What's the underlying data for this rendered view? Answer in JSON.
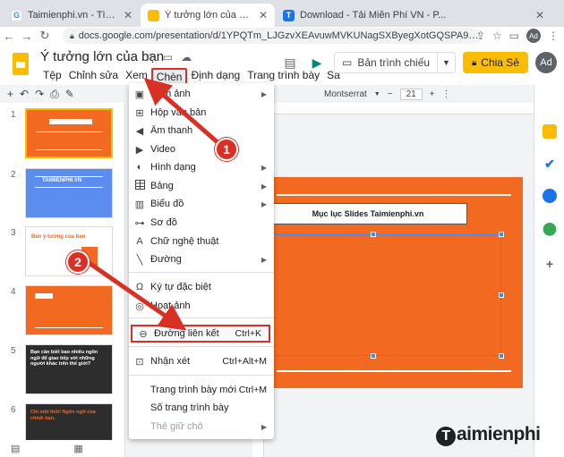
{
  "browser": {
    "tabs": [
      {
        "title": "Taimienphi.vn - Tìm trên Google",
        "favicon": "G",
        "color": "#4285f4"
      },
      {
        "title": "Ý tưởng lớn của bạn - Google Tr...",
        "favicon": "",
        "color": "#fbbc04"
      },
      {
        "title": "Download - Tải Miễn Phí VN - P...",
        "favicon": "T",
        "color": "#1a73e8"
      }
    ],
    "url": "docs.google.com/presentation/d/1YPQTm_LJGzvXEAvuwMVKUNagSXByegXotGQSPA9Cik/edit#slide=i...",
    "profile_initials": "Ad"
  },
  "header": {
    "doc_title": "Ý tưởng lớn của bạn",
    "menu": [
      "Tệp",
      "Chỉnh sửa",
      "Xem",
      "Chèn",
      "Định dạng",
      "Trang trình bày",
      "Sắ"
    ],
    "present_label": "Bản trình chiếu",
    "share_label": "Chia Sẻ",
    "avatar_initials": "Ad"
  },
  "toolbar": {
    "font_name": "Montserrat",
    "font_size": "21"
  },
  "slides": [
    {
      "num": "1",
      "bg": "#f26a21",
      "text": "Ý tưởng lớn của bạn"
    },
    {
      "num": "2",
      "bg": "#5b8def",
      "text": "TAIMIENPHI.VN"
    },
    {
      "num": "3",
      "bg": "#ffffff",
      "text": "Bản ý tưởng của bạn"
    },
    {
      "num": "4",
      "bg": "#f26a21",
      "text": ""
    },
    {
      "num": "5",
      "bg": "#2d2d2d",
      "text": "Bạn cần biết bao nhiêu ngôn ngữ để giao tiếp với những người khác trên thế giới?"
    },
    {
      "num": "6",
      "bg": "#2d2d2d",
      "text": "Chỉ một thôi! Ngôn ngữ của chính bạn."
    }
  ],
  "slide_content": {
    "title": "Mục lục Slides Taimienphi.vn"
  },
  "insert_menu": {
    "items": [
      {
        "icon": "image-icon",
        "glyph": "▣",
        "label": "Hình ảnh",
        "shortcut": "",
        "submenu": true
      },
      {
        "icon": "textbox-icon",
        "glyph": "⊞",
        "label": "Hộp văn bản",
        "shortcut": "",
        "submenu": false
      },
      {
        "icon": "audio-icon",
        "glyph": "◀",
        "label": "Âm thanh",
        "shortcut": "",
        "submenu": false
      },
      {
        "icon": "video-icon",
        "glyph": "▶",
        "label": "Video",
        "shortcut": "",
        "submenu": false
      },
      {
        "icon": "shape-icon",
        "glyph": "◐",
        "label": "Hình dạng",
        "shortcut": "",
        "submenu": true
      },
      {
        "icon": "table-icon",
        "glyph": "",
        "label": "Bảng",
        "shortcut": "",
        "submenu": true
      },
      {
        "icon": "chart-icon",
        "glyph": "▥",
        "label": "Biểu đồ",
        "shortcut": "",
        "submenu": true
      },
      {
        "icon": "diagram-icon",
        "glyph": "⊶",
        "label": "Sơ đồ",
        "shortcut": "",
        "submenu": false
      },
      {
        "icon": "wordart-icon",
        "glyph": "A",
        "label": "Chữ nghệ thuật",
        "shortcut": "",
        "submenu": false
      },
      {
        "icon": "line-icon",
        "glyph": "╲",
        "label": "Đường",
        "shortcut": "",
        "submenu": true
      },
      {
        "icon": "special-chars-icon",
        "glyph": "Ω",
        "label": "Ký tự đặc biệt",
        "shortcut": "",
        "submenu": false
      },
      {
        "icon": "animation-icon",
        "glyph": "◎",
        "label": "Hoạt ảnh",
        "shortcut": "",
        "submenu": false
      },
      {
        "icon": "link-icon",
        "glyph": "⊖",
        "label": "Đường liên kết",
        "shortcut": "Ctrl+K",
        "submenu": false
      },
      {
        "icon": "comment-icon",
        "glyph": "⊡",
        "label": "Nhận xét",
        "shortcut": "Ctrl+Alt+M",
        "submenu": false
      },
      {
        "icon": "",
        "glyph": "",
        "label": "Trang trình bày mới",
        "shortcut": "Ctrl+M",
        "submenu": false
      },
      {
        "icon": "",
        "glyph": "",
        "label": "Số trang trình bày",
        "shortcut": "",
        "submenu": false
      },
      {
        "icon": "",
        "glyph": "",
        "label": "Thẻ giữ chỗ",
        "shortcut": "",
        "submenu": true,
        "disabled": true
      }
    ]
  },
  "annotations": {
    "step1": "1",
    "step2": "2"
  },
  "watermark": {
    "text": "aimienphi",
    "t": "T"
  },
  "colors": {
    "accent_yellow": "#fbbc04",
    "slide_orange": "#f26a21",
    "annotation_red": "#d93025"
  }
}
